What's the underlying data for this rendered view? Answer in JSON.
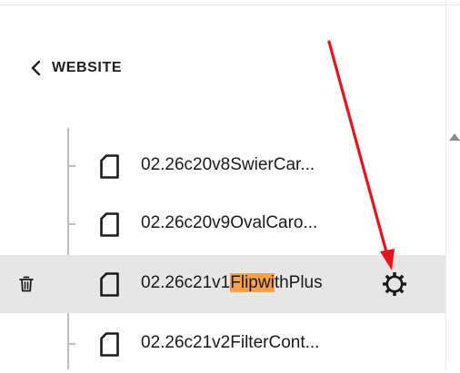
{
  "nav": {
    "back_label": "WEBSITE"
  },
  "pages": [
    {
      "label": "02.26c20v8SwierCar..."
    },
    {
      "label": "02.26c20v9OvalCaro..."
    },
    {
      "label_before": "02.26c21v1",
      "label_highlight": "Flipwi",
      "label_after": "thPlus",
      "active": true
    },
    {
      "label": "02.26c21v2FilterCont..."
    }
  ],
  "colors": {
    "highlight": "#f7a14c",
    "active_row": "#e6e6e6",
    "annotation_arrow": "#e8141b"
  },
  "icons": [
    "chevron-left-icon",
    "file-icon",
    "trash-icon",
    "gear-icon",
    "scroll-up-icon"
  ]
}
